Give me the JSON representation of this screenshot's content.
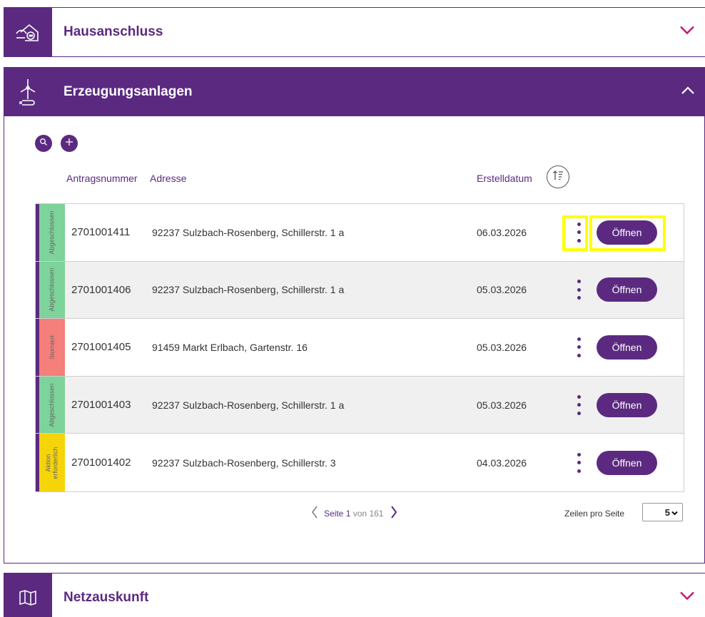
{
  "panels": {
    "hausanschluss": {
      "title": "Hausanschluss",
      "icon": "house-plug-icon"
    },
    "erzeugung": {
      "title": "Erzeugungsanlagen",
      "icon": "wind-turbine-icon"
    },
    "netzauskunft": {
      "title": "Netzauskunft",
      "icon": "map-icon"
    }
  },
  "toolbar": {
    "search_icon": "search-icon",
    "add_icon": "plus-icon"
  },
  "columns": {
    "nr": "Antragsnummer",
    "address": "Adresse",
    "date": "Erstelldatum"
  },
  "rows": [
    {
      "status": "Abgeschlossen",
      "nr": "2701001411",
      "address": "92237 Sulzbach-Rosenberg, Schillerstr. 1 a",
      "date": "06.03.2026",
      "action": "Öffnen"
    },
    {
      "status": "Abgeschlossen",
      "nr": "2701001406",
      "address": "92237 Sulzbach-Rosenberg, Schillerstr. 1 a",
      "date": "05.03.2026",
      "action": "Öffnen"
    },
    {
      "status": "Storniert",
      "nr": "2701001405",
      "address": "91459 Markt Erlbach, Gartenstr. 16",
      "date": "05.03.2026",
      "action": "Öffnen"
    },
    {
      "status": "Abgeschlossen",
      "nr": "2701001403",
      "address": "92237 Sulzbach-Rosenberg, Schillerstr. 1 a",
      "date": "05.03.2026",
      "action": "Öffnen"
    },
    {
      "status_line1": "Aktion",
      "status_line2": "erforderlich",
      "nr": "2701001402",
      "address": "92237 Sulzbach-Rosenberg, Schillerstr. 3",
      "date": "04.03.2026",
      "action": "Öffnen"
    }
  ],
  "pagination": {
    "page_word": "Seite",
    "current": "1",
    "of_word": "von",
    "total": "161"
  },
  "rows_per_page": {
    "label": "Zeilen pro Seite",
    "value": "5"
  },
  "colors": {
    "primary": "#5b2a80",
    "done": "#7dd39a",
    "cancelled": "#f57f7a",
    "action": "#f6d40a",
    "highlight": "#ffff00"
  }
}
